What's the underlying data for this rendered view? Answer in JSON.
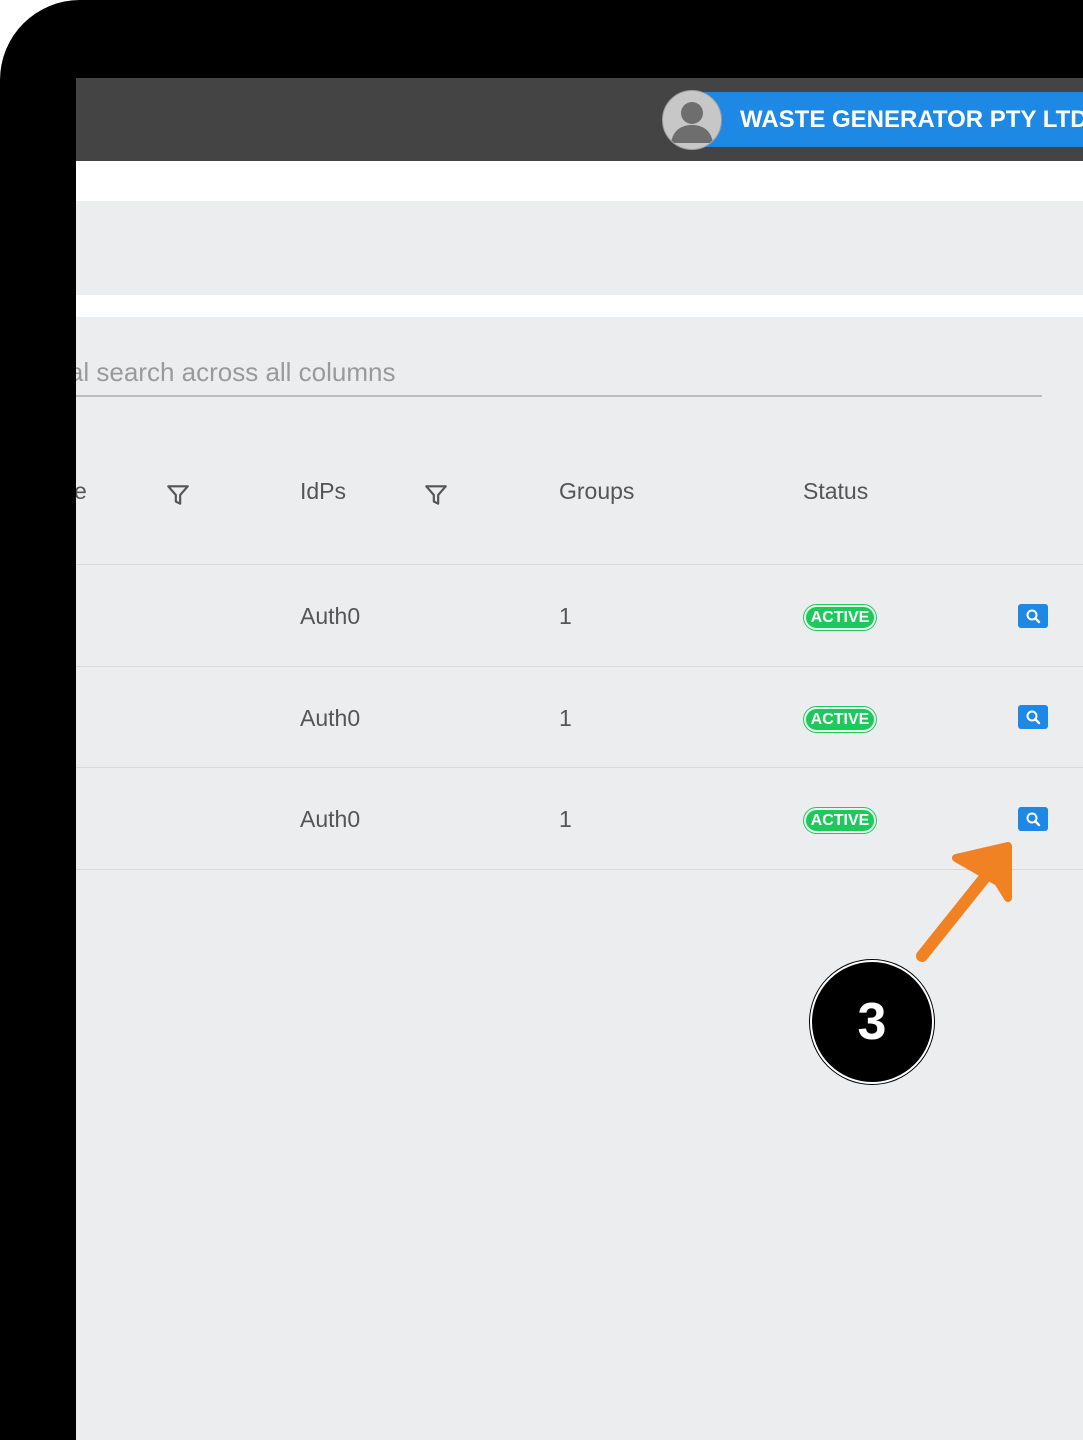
{
  "header": {
    "account_name": "WASTE GENERATOR PTY LTD",
    "avatar_icon": "user-avatar-icon",
    "accent_color": "#1e88e5"
  },
  "search": {
    "placeholder": "Global search across all columns"
  },
  "table": {
    "columns": [
      {
        "label": "e",
        "filter_icon": "funnel-icon"
      },
      {
        "label": "IdPs",
        "filter_icon": "funnel-icon"
      },
      {
        "label": "Groups"
      },
      {
        "label": "Status"
      }
    ],
    "rows": [
      {
        "idp": "Auth0",
        "groups": "1",
        "status": "ACTIVE",
        "action_icon": "search-icon"
      },
      {
        "idp": "Auth0",
        "groups": "1",
        "status": "ACTIVE",
        "action_icon": "search-icon"
      },
      {
        "idp": "Auth0",
        "groups": "1",
        "status": "ACTIVE",
        "action_icon": "search-icon"
      }
    ],
    "status_color": "#1ec95c"
  },
  "annotation": {
    "step_number": "3",
    "arrow_color": "#f08224"
  }
}
